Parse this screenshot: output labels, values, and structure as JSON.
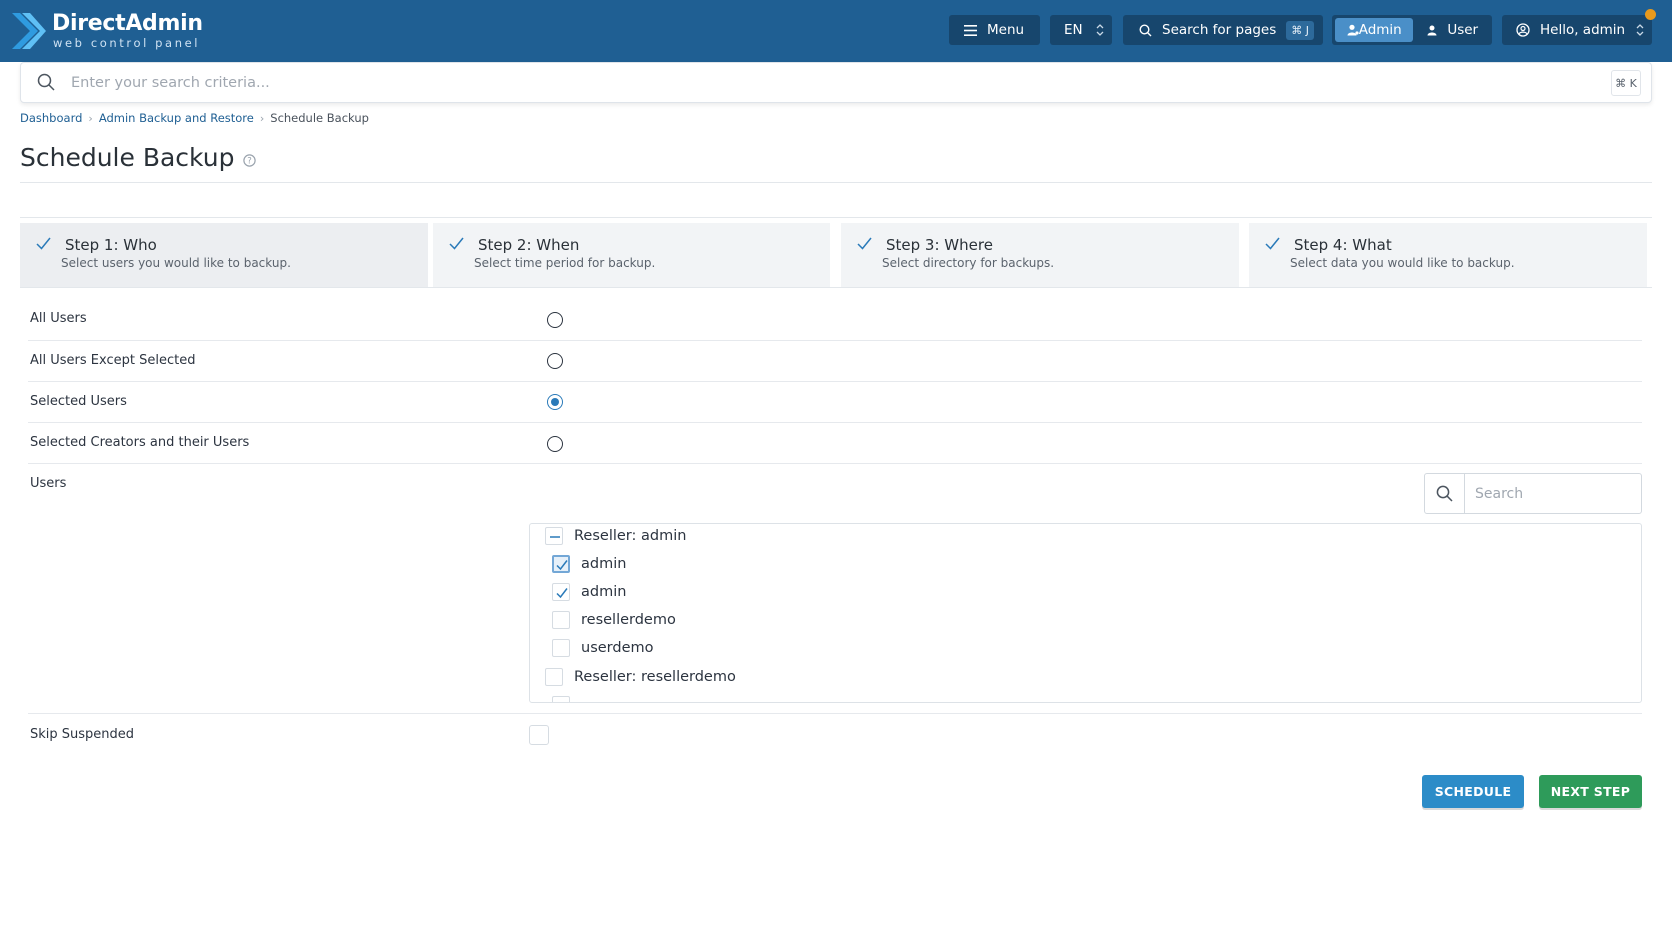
{
  "header": {
    "logo_title": "DirectAdmin",
    "logo_subtitle": "web control panel",
    "menu_label": "Menu",
    "language": "EN",
    "search_pages_label": "Search for pages",
    "search_pages_shortcut": "⌘ J",
    "role_admin": "Admin",
    "role_user": "User",
    "greeting": "Hello, admin",
    "colors": {
      "bar": "#1f5f93",
      "button": "#17466d",
      "active_role": "#4a8fc8",
      "notification": "#e89a1d"
    }
  },
  "global_search": {
    "placeholder": "Enter your search criteria...",
    "shortcut": "⌘ K"
  },
  "breadcrumb": [
    "Dashboard",
    "Admin Backup and Restore",
    "Schedule Backup"
  ],
  "page_title": "Schedule Backup",
  "steps": [
    {
      "title": "Step 1: Who",
      "desc": "Select users you would like to backup.",
      "active": true
    },
    {
      "title": "Step 2: When",
      "desc": "Select time period for backup.",
      "active": false
    },
    {
      "title": "Step 3: Where",
      "desc": "Select directory for backups.",
      "active": false
    },
    {
      "title": "Step 4: What",
      "desc": "Select data you would like to backup.",
      "active": false
    }
  ],
  "options": [
    {
      "label": "All Users",
      "selected": false
    },
    {
      "label": "All Users Except Selected",
      "selected": false
    },
    {
      "label": "Selected Users",
      "selected": true
    },
    {
      "label": "Selected Creators and their Users",
      "selected": false
    }
  ],
  "users": {
    "label": "Users",
    "search_placeholder": "Search",
    "tree": [
      {
        "label": "Reseller: admin",
        "state": "indeterminate",
        "level": 0
      },
      {
        "label": "admin",
        "state": "checked-focused",
        "level": 1
      },
      {
        "label": "admin",
        "state": "checked",
        "level": 1
      },
      {
        "label": "resellerdemo",
        "state": "unchecked",
        "level": 1
      },
      {
        "label": "userdemo",
        "state": "unchecked",
        "level": 1
      },
      {
        "label": "Reseller: resellerdemo",
        "state": "unchecked",
        "level": 0
      }
    ]
  },
  "skip_suspended": {
    "label": "Skip Suspended",
    "checked": false
  },
  "actions": {
    "schedule": "SCHEDULE",
    "next_step": "NEXT STEP",
    "colors": {
      "schedule": "#2c8cc8",
      "next_step": "#2e9b5a"
    }
  }
}
